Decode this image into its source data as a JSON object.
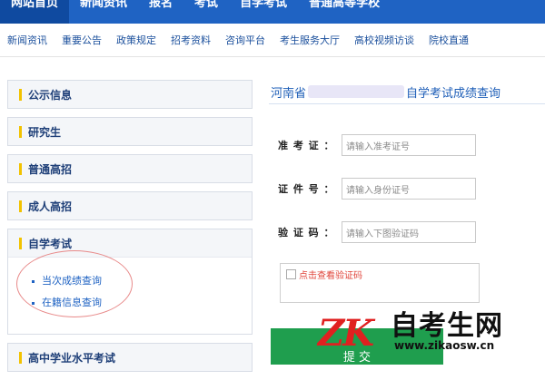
{
  "topnav": {
    "items": [
      "网站首页",
      "新闻资讯",
      "报名",
      "考试",
      "自学考试",
      "普通高等学校"
    ]
  },
  "subnav": {
    "items": [
      "新闻资讯",
      "重要公告",
      "政策规定",
      "招考资料",
      "咨询平台",
      "考生服务大厅",
      "高校视频访谈",
      "院校直通"
    ]
  },
  "sidebar": {
    "panels": [
      "公示信息",
      "研究生",
      "普通高招",
      "成人高招"
    ],
    "expanded": {
      "label": "自学考试",
      "links": [
        "当次成绩查询",
        "在籍信息查询"
      ]
    },
    "last_panel": "高中学业水平考试"
  },
  "main": {
    "title_prefix": "河南省",
    "title_suffix": "自学考试成绩查询",
    "fields": [
      {
        "label": "准 考 证 ：",
        "placeholder": "请输入准考证号"
      },
      {
        "label": "证 件 号 ：",
        "placeholder": "请输入身份证号"
      },
      {
        "label": "验 证 码 ：",
        "placeholder": "请输入下图验证码"
      }
    ],
    "captcha_text": "点击查看验证码",
    "submit_label": "提 交"
  },
  "watermark": {
    "logo": "ZK",
    "cn": "自考生网",
    "url": "www.zikaosw.cn"
  },
  "colors": {
    "nav_blue": "#1f63c3",
    "accent_yellow": "#f2c200",
    "submit_green": "#1f9e4e",
    "highlight_red": "#e88a8a"
  }
}
